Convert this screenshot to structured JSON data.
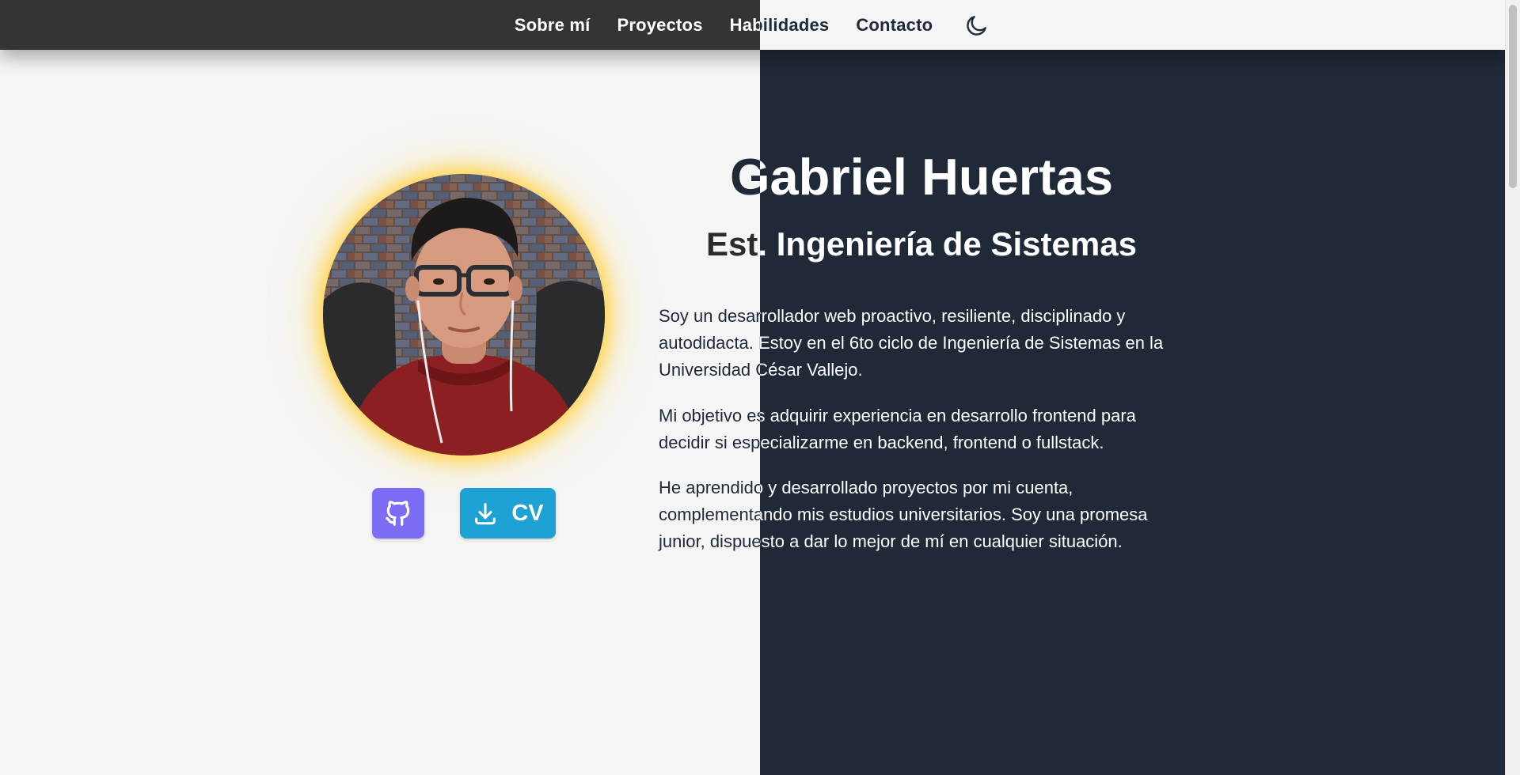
{
  "nav": {
    "items": [
      {
        "label": "Sobre mí"
      },
      {
        "label": "Proyectos"
      },
      {
        "label": "Habilidades"
      },
      {
        "label": "Contacto"
      }
    ],
    "theme_toggle_icon": "moon-icon"
  },
  "hero": {
    "name": "Gabriel Huertas",
    "subtitle": "Est. Ingeniería de Sistemas",
    "paragraphs": [
      "Soy un desarrollador web proactivo, resiliente, disciplinado y autodidacta. Estoy en el 6to ciclo de Ingeniería de Sistemas en la Universidad César Vallejo.",
      "Mi objetivo es adquirir experiencia en desarrollo frontend para decidir si especializarme en backend, frontend o fullstack.",
      "He aprendido y desarrollado proyectos por mi cuenta, complementando mis estudios universitarios. Soy una promesa junior, dispuesto a dar lo mejor de mí en cualquier situación."
    ]
  },
  "actions": {
    "github_icon": "github-icon",
    "cv_icon": "download-icon",
    "cv_label": "CV"
  },
  "colors": {
    "page_light": "#f5f5f5",
    "page_dark": "#1f2937",
    "navbar_dark": "#333533",
    "github_button": "#7c6cf6",
    "cv_button": "#1ea1d4",
    "avatar_glow": "#ffd65a"
  }
}
